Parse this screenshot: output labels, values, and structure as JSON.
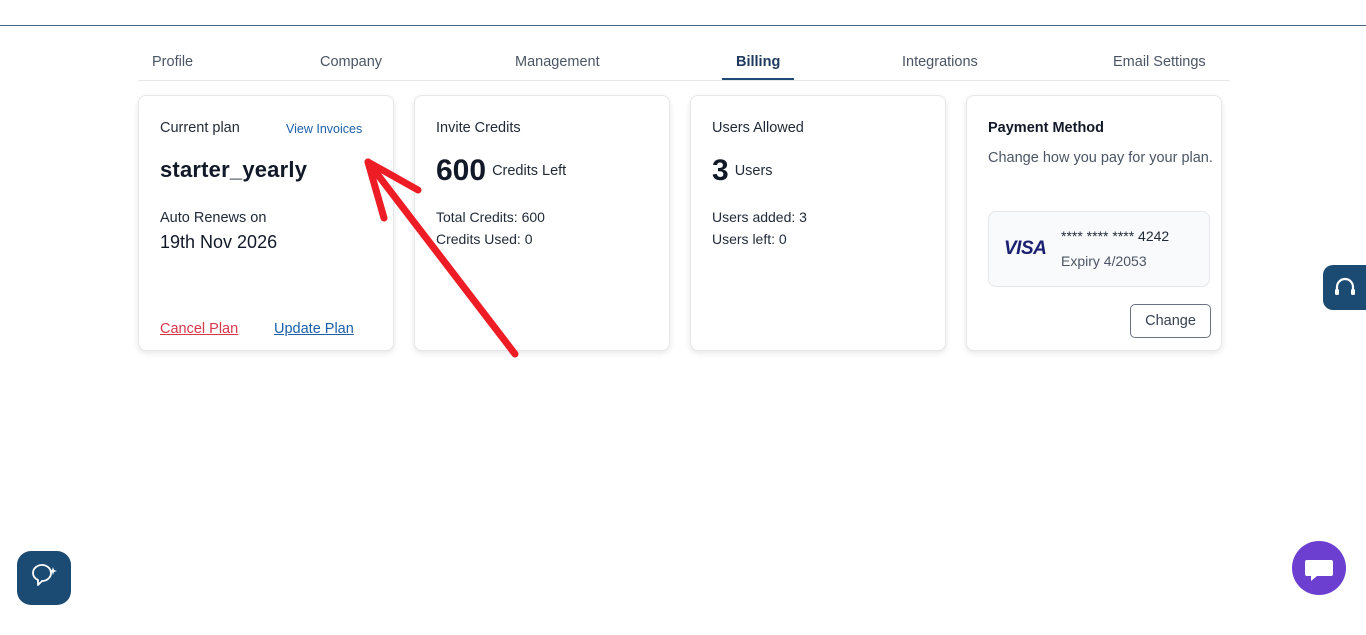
{
  "tabs": [
    {
      "label": "Profile"
    },
    {
      "label": "Company"
    },
    {
      "label": "Management"
    },
    {
      "label": "Billing",
      "active": true
    },
    {
      "label": "Integrations"
    },
    {
      "label": "Email Settings"
    }
  ],
  "current_plan": {
    "title": "Current plan",
    "view_invoices": "View Invoices",
    "plan_name": "starter_yearly",
    "renew_label": "Auto Renews on",
    "renew_date": "19th Nov 2026",
    "cancel_label": "Cancel Plan",
    "update_label": "Update Plan"
  },
  "invite_credits": {
    "title": "Invite Credits",
    "count": "600",
    "unit": "Credits Left",
    "total": "Total Credits: 600",
    "used": "Credits Used: 0"
  },
  "users_allowed": {
    "title": "Users Allowed",
    "count": "3",
    "unit": "Users",
    "added": "Users added: 3",
    "left": "Users left: 0"
  },
  "payment_method": {
    "title": "Payment Method",
    "description": "Change how you pay for your plan.",
    "card_brand": "VISA",
    "card_number": "**** **** **** 4242",
    "expiry": "Expiry 4/2053",
    "change_label": "Change"
  },
  "icons": {
    "help": "headset-icon",
    "chat_left": "chat-sparkle-icon",
    "chat_right": "chat-bubble-icon"
  },
  "colors": {
    "primary": "#1b4a73",
    "link": "#1d5fa8",
    "danger": "#d9364a",
    "chat_purple": "#6d3fd1",
    "annotation_red": "#ee1c24"
  }
}
